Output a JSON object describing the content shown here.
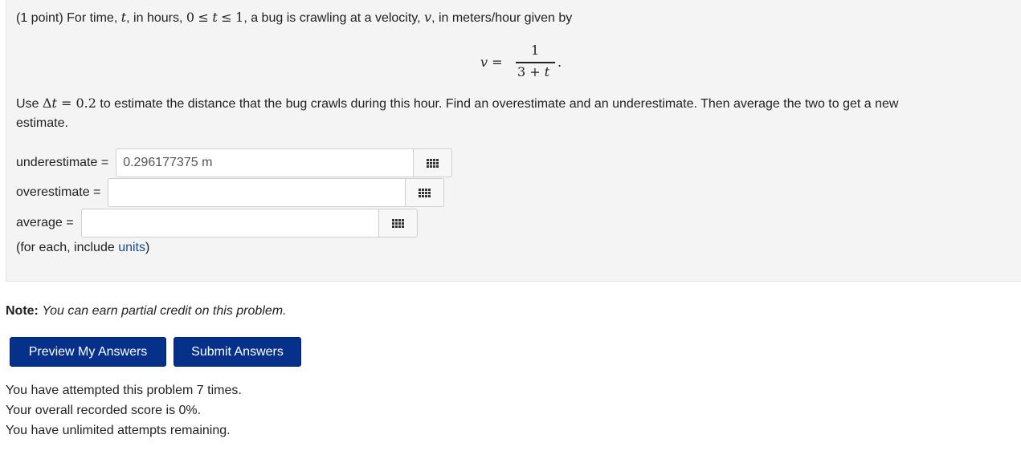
{
  "problem": {
    "intro_part1": "(1 point) For time,",
    "var_t": "t",
    "intro_part2": ", in hours,",
    "range_zero": "0",
    "leq": "≤",
    "range_one": "1",
    "intro_part3": ", a bug is crawling at a velocity,",
    "var_v": "v",
    "intro_part4": ", in meters/hour given by",
    "formula": {
      "lhs": "v =",
      "numerator": "1",
      "denominator_three": "3 + ",
      "denominator_t": "t",
      "period": "."
    },
    "instr_use": "Use",
    "delta": "Δ",
    "eq_value": " = 0.2",
    "instr_rest_line1": " to estimate the distance that the bug crawls during this hour. Find an overestimate and an underestimate. Then average the two to get a new",
    "instr_rest_line2": "estimate."
  },
  "answers": {
    "underestimate": {
      "label": "underestimate =",
      "value": "0.296177375 m"
    },
    "overestimate": {
      "label": "overestimate =",
      "value": ""
    },
    "average": {
      "label": "average =",
      "value": ""
    },
    "units_hint_before": "(for each, include ",
    "units_link": "units",
    "units_hint_after": ")",
    "equation_editor_icon": "grid-icon"
  },
  "note": {
    "label": "Note:",
    "text": "You can earn partial credit on this problem."
  },
  "buttons": {
    "preview": "Preview My Answers",
    "submit": "Submit Answers"
  },
  "status": {
    "attempts": "You have attempted this problem 7 times.",
    "score": "Your overall recorded score is 0%.",
    "remaining": "You have unlimited attempts remaining."
  },
  "colors": {
    "button_bg": "#06318a",
    "link": "#1b4a93",
    "panel_bg": "#f4f4f4"
  }
}
